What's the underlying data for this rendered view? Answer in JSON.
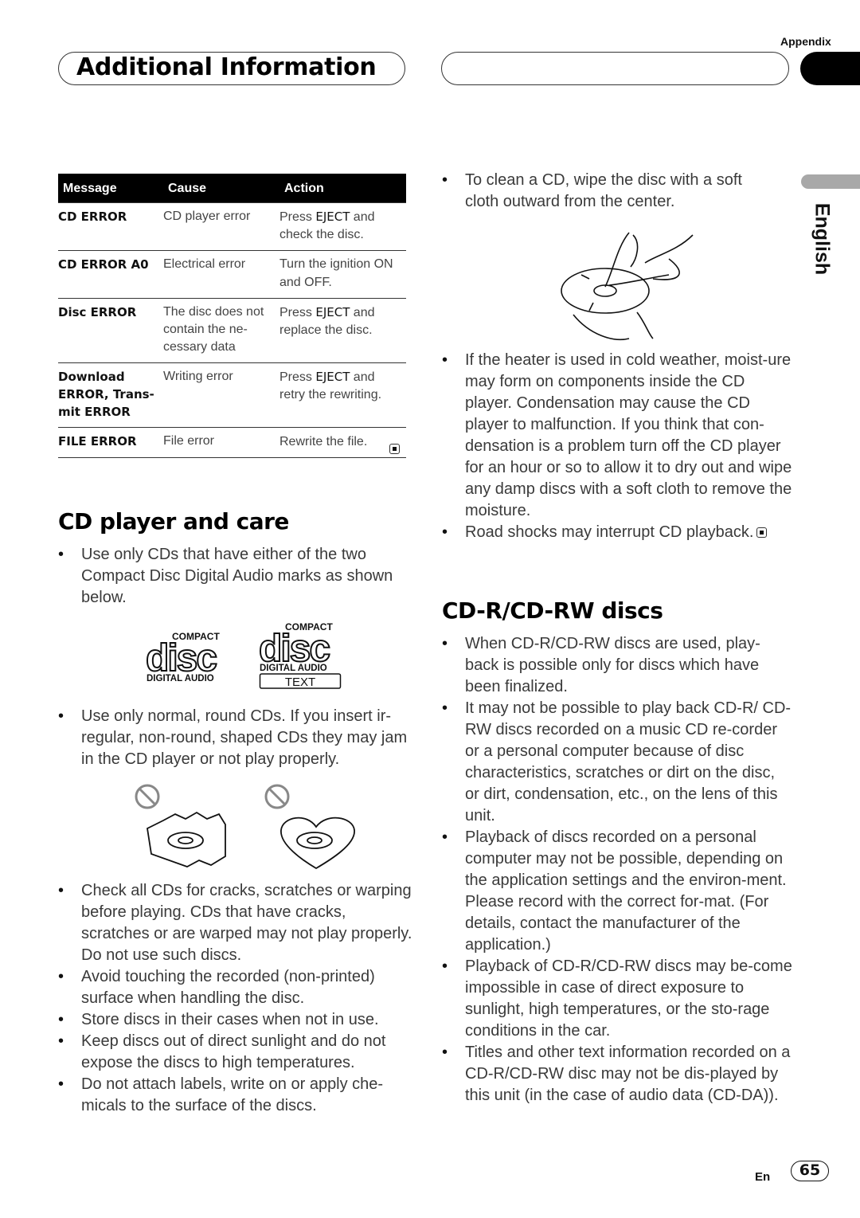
{
  "header": {
    "section_title": "Additional Information",
    "chapter_label": "Appendix",
    "language_tab": "English"
  },
  "error_table": {
    "columns": [
      "Message",
      "Cause",
      "Action"
    ],
    "rows": [
      {
        "message": "CD ERROR",
        "cause": "CD player error",
        "action_pre": "Press ",
        "action_bold": "EJECT",
        "action_post": " and check the disc."
      },
      {
        "message": "CD ERROR A0",
        "cause": "Electrical error",
        "action_pre": "Turn the ignition ON and OFF.",
        "action_bold": "",
        "action_post": ""
      },
      {
        "message": "Disc ERROR",
        "cause": "The disc does not contain the ne-cessary data",
        "action_pre": "Press ",
        "action_bold": "EJECT",
        "action_post": " and replace the disc."
      },
      {
        "message": "Download ERROR, Trans-mit ERROR",
        "cause": "Writing error",
        "action_pre": "Press ",
        "action_bold": "EJECT",
        "action_post": " and retry the rewriting."
      },
      {
        "message": "FILE ERROR",
        "cause": "File error",
        "action_pre": "Rewrite the file.",
        "action_bold": "",
        "action_post": ""
      }
    ]
  },
  "cd_care": {
    "heading": "CD player and care",
    "bullets_intro": [
      "Use only CDs that have either of the two Compact Disc Digital Audio marks as shown below."
    ],
    "logos": {
      "compact": "COMPACT",
      "disc": "disc",
      "digital_audio": "DIGITAL AUDIO",
      "text_badge": "TEXT"
    },
    "bullets_shape": [
      "Use only normal, round CDs. If you insert ir-regular, non-round, shaped CDs they may jam in the CD player or not play properly."
    ],
    "bullets_more": [
      "Check all CDs for cracks, scratches or warping before playing. CDs that have cracks, scratches or are warped may not play properly. Do not use such discs.",
      "Avoid touching the recorded (non-printed) surface when handling the disc.",
      "Store discs in their cases when not in use.",
      "Keep discs out of direct sunlight and do not expose the discs to high temperatures.",
      "Do not attach labels, write on or apply che-micals to the surface of the discs."
    ]
  },
  "right_col": {
    "bullets_clean": [
      "To clean a CD, wipe the disc with a soft cloth outward from the center."
    ],
    "bullets_heater": [
      "If the heater is used in cold weather, moist-ure may form on components inside the CD player. Condensation may cause the CD player to malfunction. If you think that con-densation is a problem turn off the CD player for an hour or so to allow it to dry out and wipe any damp discs with a soft cloth to remove the moisture.",
      "Road shocks may interrupt CD playback."
    ]
  },
  "cdr": {
    "heading": "CD-R/CD-RW discs",
    "bullets": [
      "When CD-R/CD-RW discs are used, play-back is possible only for discs which have been finalized.",
      "It may not be possible to play back CD-R/ CD-RW discs recorded on a music CD re-corder or a personal computer because of disc characteristics, scratches or dirt on the disc, or dirt, condensation, etc., on the lens of this unit.",
      "Playback of discs recorded on a personal computer may not be possible, depending on the application settings and the environ-ment. Please record with the correct for-mat. (For details, contact the manufacturer of the application.)",
      "Playback of CD-R/CD-RW discs may be-come impossible in case of direct exposure to sunlight, high temperatures, or the sto-rage conditions in the car.",
      "Titles and other text information recorded on a CD-R/CD-RW disc may not be dis-played by this unit (in the case of audio data (CD-DA))."
    ]
  },
  "footer": {
    "lang_code": "En",
    "page_number": "65"
  }
}
